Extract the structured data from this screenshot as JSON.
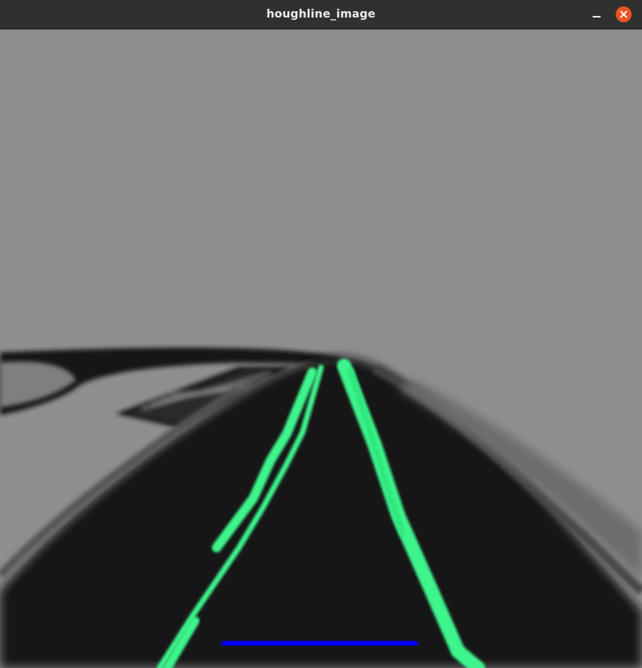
{
  "window": {
    "title": "houghline_image",
    "buttons": {
      "minimize_icon": "minimize-icon",
      "close_icon": "close-icon"
    },
    "colors": {
      "titlebar": "#303030",
      "title_text": "#ececec",
      "close_button": "#e95420"
    }
  },
  "image": {
    "colors": {
      "background": "#8f8f8f",
      "road": "#151515",
      "hough_lines": "#3df58c",
      "detected_line": "#0000ff"
    }
  }
}
